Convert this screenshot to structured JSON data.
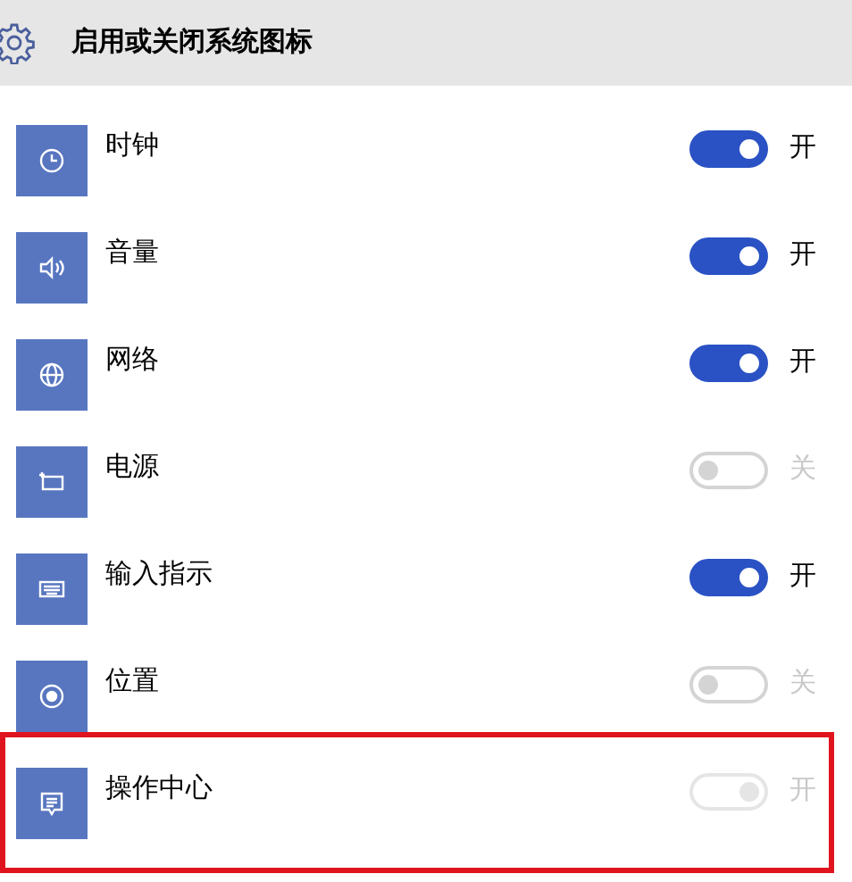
{
  "header": {
    "title": "启用或关闭系统图标"
  },
  "items": [
    {
      "kind": "clock",
      "label": "时钟",
      "on": true,
      "disabled": false,
      "highlighted": false,
      "state_label": "开"
    },
    {
      "kind": "volume",
      "label": "音量",
      "on": true,
      "disabled": false,
      "highlighted": false,
      "state_label": "开"
    },
    {
      "kind": "globe",
      "label": "网络",
      "on": true,
      "disabled": false,
      "highlighted": false,
      "state_label": "开"
    },
    {
      "kind": "battery",
      "label": "电源",
      "on": false,
      "disabled": true,
      "highlighted": false,
      "state_label": "关"
    },
    {
      "kind": "keyboard",
      "label": "输入指示",
      "on": true,
      "disabled": false,
      "highlighted": false,
      "state_label": "开"
    },
    {
      "kind": "location",
      "label": "位置",
      "on": false,
      "disabled": true,
      "highlighted": false,
      "state_label": "关"
    },
    {
      "kind": "message",
      "label": "操作中心",
      "on": true,
      "disabled": true,
      "highlighted": true,
      "state_label": "开"
    }
  ]
}
